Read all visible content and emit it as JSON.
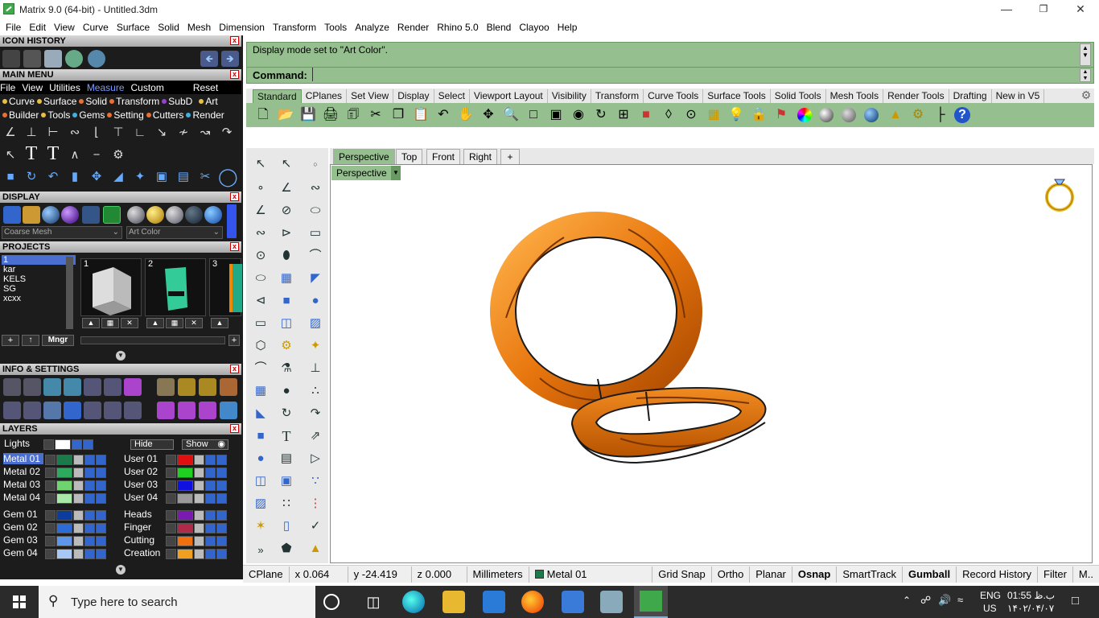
{
  "window": {
    "title": "Matrix 9.0 (64-bit) - Untitled.3dm"
  },
  "menubar": [
    "File",
    "Edit",
    "View",
    "Curve",
    "Surface",
    "Solid",
    "Mesh",
    "Dimension",
    "Transform",
    "Tools",
    "Analyze",
    "Render",
    "Rhino 5.0",
    "Blend",
    "Clayoo",
    "Help"
  ],
  "panels": {
    "icon_history": "ICON HISTORY",
    "main_menu": "MAIN MENU",
    "display": "DISPLAY",
    "projects": "PROJECTS",
    "info_settings": "INFO & SETTINGS",
    "layers": "LAYERS"
  },
  "main_menu": {
    "row1": [
      "File",
      "View",
      "Utilities",
      "Measure",
      "Custom",
      "Reset"
    ],
    "row2": [
      "Curve",
      "Surface",
      "Solid",
      "Transform",
      "SubD",
      "Art"
    ],
    "row3": [
      "Builder",
      "Tools",
      "Gems",
      "Setting",
      "Cutters",
      "Render"
    ]
  },
  "display": {
    "mesh_select": "Coarse Mesh",
    "mode_select": "Art Color"
  },
  "projects": {
    "list": [
      "1",
      "kar",
      "KELS",
      "SG",
      "xcxx"
    ],
    "thumb_numbers": [
      "1",
      "2",
      "3"
    ],
    "mngr": "Mngr"
  },
  "layers": {
    "lights": "Lights",
    "hide": "Hide",
    "show": "Show",
    "left_col": [
      {
        "name": "Metal 01",
        "color": "#1b7a4a"
      },
      {
        "name": "Metal 02",
        "color": "#2eaa5e"
      },
      {
        "name": "Metal 03",
        "color": "#6fd36f"
      },
      {
        "name": "Metal 04",
        "color": "#a9e8a9"
      },
      {
        "name": "Gem 01",
        "color": "#0c3c9c"
      },
      {
        "name": "Gem 02",
        "color": "#2d6cd6"
      },
      {
        "name": "Gem 03",
        "color": "#5e96ec"
      },
      {
        "name": "Gem 04",
        "color": "#a7c8f4"
      }
    ],
    "right_col": [
      {
        "name": "User 01",
        "color": "#e01010"
      },
      {
        "name": "User 02",
        "color": "#20d020"
      },
      {
        "name": "User 03",
        "color": "#1010e0"
      },
      {
        "name": "User 04",
        "color": "#9a9a9a"
      },
      {
        "name": "Heads",
        "color": "#7a1ab0"
      },
      {
        "name": "Finger",
        "color": "#b02a4a"
      },
      {
        "name": "Cutting",
        "color": "#f07010"
      },
      {
        "name": "Creation",
        "color": "#f0a020"
      }
    ]
  },
  "command": {
    "history": "Display mode set to \"Art Color\".",
    "prompt": "Command:"
  },
  "toolbar_tabs": [
    "Standard",
    "CPlanes",
    "Set View",
    "Display",
    "Select",
    "Viewport Layout",
    "Visibility",
    "Transform",
    "Curve Tools",
    "Surface Tools",
    "Solid Tools",
    "Mesh Tools",
    "Render Tools",
    "Drafting",
    "New in V5"
  ],
  "viewport_tabs": [
    "Perspective",
    "Top",
    "Front",
    "Right"
  ],
  "viewport_label": "Perspective",
  "statusbar": {
    "cplane": "CPlane",
    "x": "x 0.064",
    "y": "y -24.419",
    "z": "z 0.000",
    "units": "Millimeters",
    "layer": "Metal 01",
    "layer_color": "#1b7a4a",
    "toggles": [
      "Grid Snap",
      "Ortho",
      "Planar",
      "Osnap",
      "SmartTrack",
      "Gumball",
      "Record History",
      "Filter",
      "M.."
    ]
  },
  "taskbar": {
    "search_placeholder": "Type here to search",
    "lang1": "ENG",
    "lang2": "US",
    "time": "01:55 ب.ظ",
    "date": "۱۴۰۲/۰۴/۰۷"
  },
  "colors": {
    "accent_green": "#95bf8e",
    "ring_orange": "#e8760e",
    "panel_dark": "#1c1c1c"
  }
}
